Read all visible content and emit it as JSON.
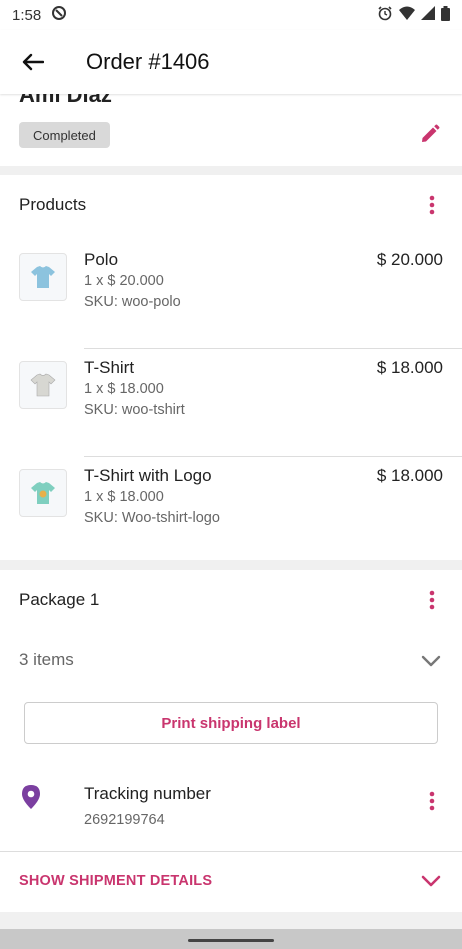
{
  "status_bar": {
    "time": "1:58"
  },
  "header": {
    "title": "Order #1406"
  },
  "customer": {
    "name": "Ami Diaz",
    "status": "Completed"
  },
  "products": {
    "title": "Products",
    "items": [
      {
        "name": "Polo",
        "qty_price": "1 x $ 20.000",
        "sku": "SKU: woo-polo",
        "total": "$ 20.000",
        "thumb_color": "#8cc3de"
      },
      {
        "name": "T-Shirt",
        "qty_price": "1 x $ 18.000",
        "sku": "SKU: woo-tshirt",
        "total": "$ 18.000",
        "thumb_color": "#d7d7d2"
      },
      {
        "name": "T-Shirt with Logo",
        "qty_price": "1 x $ 18.000",
        "sku": "SKU: Woo-tshirt-logo",
        "total": "$ 18.000",
        "thumb_color": "#7fcfbf"
      }
    ]
  },
  "package": {
    "title": "Package 1",
    "items_count": "3 items",
    "print_label": "Print shipping label",
    "tracking": {
      "label": "Tracking number",
      "number": "2692199764"
    },
    "show_shipment": "SHOW SHIPMENT DETAILS"
  },
  "colors": {
    "accent": "#c9356e",
    "pin": "#7b3fa0"
  },
  "icons": [
    "back-arrow-icon",
    "pencil-icon",
    "more-vert-icon",
    "chevron-down-icon",
    "location-pin-icon",
    "alarm-icon",
    "wifi-icon",
    "signal-icon",
    "battery-icon"
  ]
}
